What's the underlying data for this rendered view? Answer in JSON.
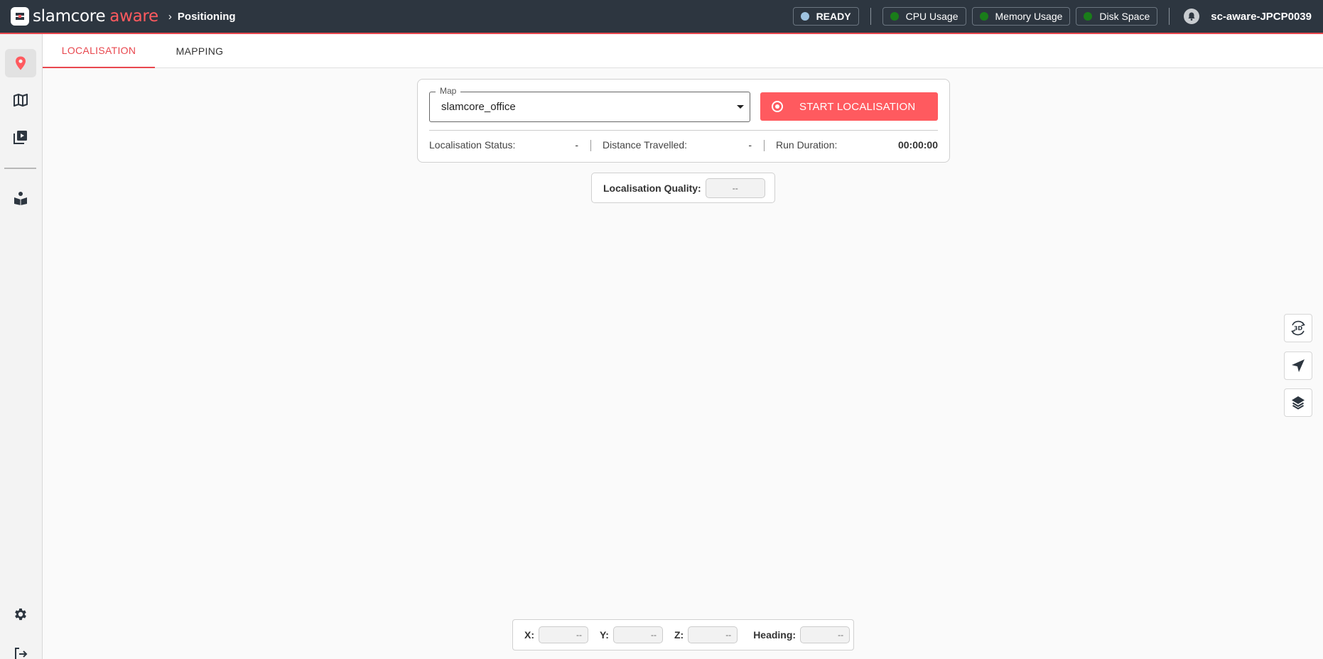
{
  "header": {
    "brand": "slamcore",
    "brand_accent": "aware",
    "breadcrumb_sep": "›",
    "breadcrumb": "Positioning",
    "status": {
      "label": "READY",
      "color": "#9fc3e0"
    },
    "health": [
      {
        "label": "CPU Usage",
        "color": "#1a7d1a"
      },
      {
        "label": "Memory Usage",
        "color": "#1a7d1a"
      },
      {
        "label": "Disk Space",
        "color": "#1a7d1a"
      }
    ],
    "device_name": "sc-aware-JPCP0039"
  },
  "sidebar": {
    "items": [
      {
        "icon": "location-pin-icon",
        "active": true
      },
      {
        "icon": "map-icon",
        "active": false
      },
      {
        "icon": "video-library-icon",
        "active": false
      },
      {
        "icon": "read-book-icon",
        "active": false
      },
      {
        "icon": "gear-icon",
        "active": false
      },
      {
        "icon": "logout-icon",
        "active": false
      }
    ]
  },
  "tabs": [
    {
      "label": "LOCALISATION",
      "active": true
    },
    {
      "label": "MAPPING",
      "active": false
    }
  ],
  "controls": {
    "map_legend": "Map",
    "map_value": "slamcore_office",
    "start_label": "START LOCALISATION",
    "stats": [
      {
        "label": "Localisation Status:",
        "value": "-"
      },
      {
        "label": "Distance Travelled:",
        "value": "-"
      },
      {
        "label": "Run Duration:",
        "value": "00:00:00"
      }
    ]
  },
  "quality": {
    "label": "Localisation Quality:",
    "value": "--"
  },
  "tools": [
    {
      "icon": "3d-rotate-icon",
      "label": "3D"
    },
    {
      "icon": "navigation-arrow-icon"
    },
    {
      "icon": "layers-icon"
    }
  ],
  "coords": [
    {
      "label": "X:",
      "value": "--"
    },
    {
      "label": "Y:",
      "value": "--"
    },
    {
      "label": "Z:",
      "value": "--"
    },
    {
      "label": "Heading:",
      "value": "--"
    }
  ],
  "colors": {
    "topbar": "#2d3640",
    "accent": "#ff5a5f",
    "tab_active": "#e8474e",
    "ok": "#1a7d1a"
  }
}
